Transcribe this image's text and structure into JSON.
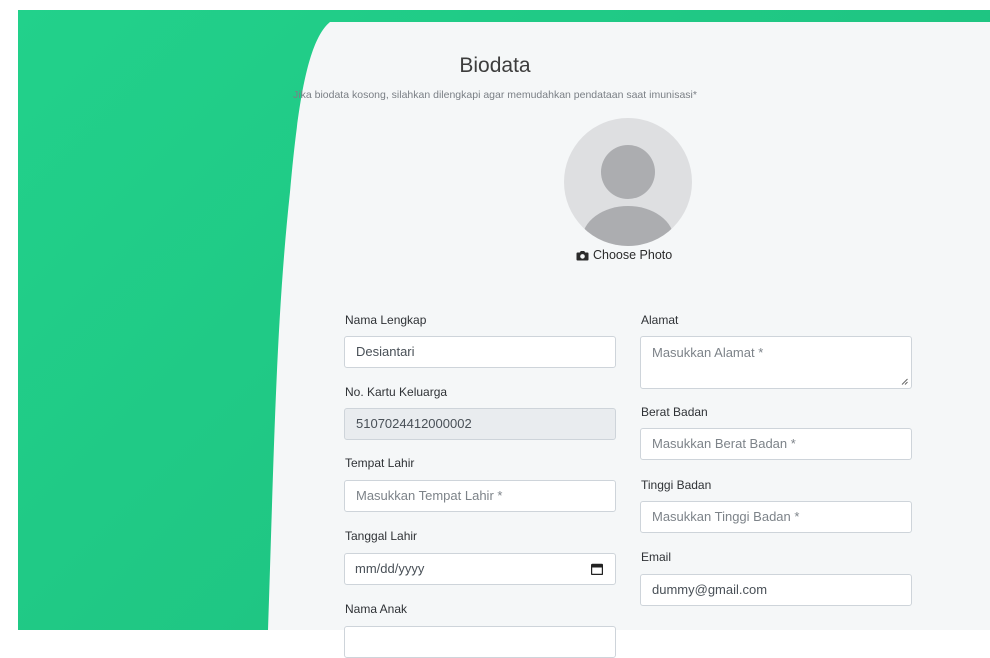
{
  "header": {
    "title": "Biodata",
    "subtitle": "Jika biodata kosong, silahkan dilengkapi agar memudahkan pendataan saat imunisasi*"
  },
  "photo": {
    "button_label": "Choose Photo",
    "icon": "camera-icon"
  },
  "form": {
    "nama_lengkap": {
      "label": "Nama Lengkap",
      "value": "Desiantari"
    },
    "no_kk": {
      "label": "No. Kartu Keluarga",
      "value": "5107024412000002"
    },
    "tempat_lahir": {
      "label": "Tempat Lahir",
      "placeholder": "Masukkan Tempat Lahir *"
    },
    "tanggal_lahir": {
      "label": "Tanggal Lahir",
      "placeholder": "mm/dd/yyyy",
      "icon": "calendar-icon"
    },
    "nama_anak": {
      "label": "Nama Anak"
    },
    "alamat": {
      "label": "Alamat",
      "placeholder": "Masukkan Alamat *"
    },
    "berat_badan": {
      "label": "Berat Badan",
      "placeholder": "Masukkan Berat Badan *"
    },
    "tinggi_badan": {
      "label": "Tinggi Badan",
      "placeholder": "Masukkan Tinggi Badan *"
    },
    "email": {
      "label": "Email",
      "value": "dummy@gmail.com"
    }
  },
  "colors": {
    "background_green": "#1fc683",
    "panel": "#f5f7f8",
    "input_border": "#ced4da",
    "disabled_input": "#e9ecef"
  }
}
